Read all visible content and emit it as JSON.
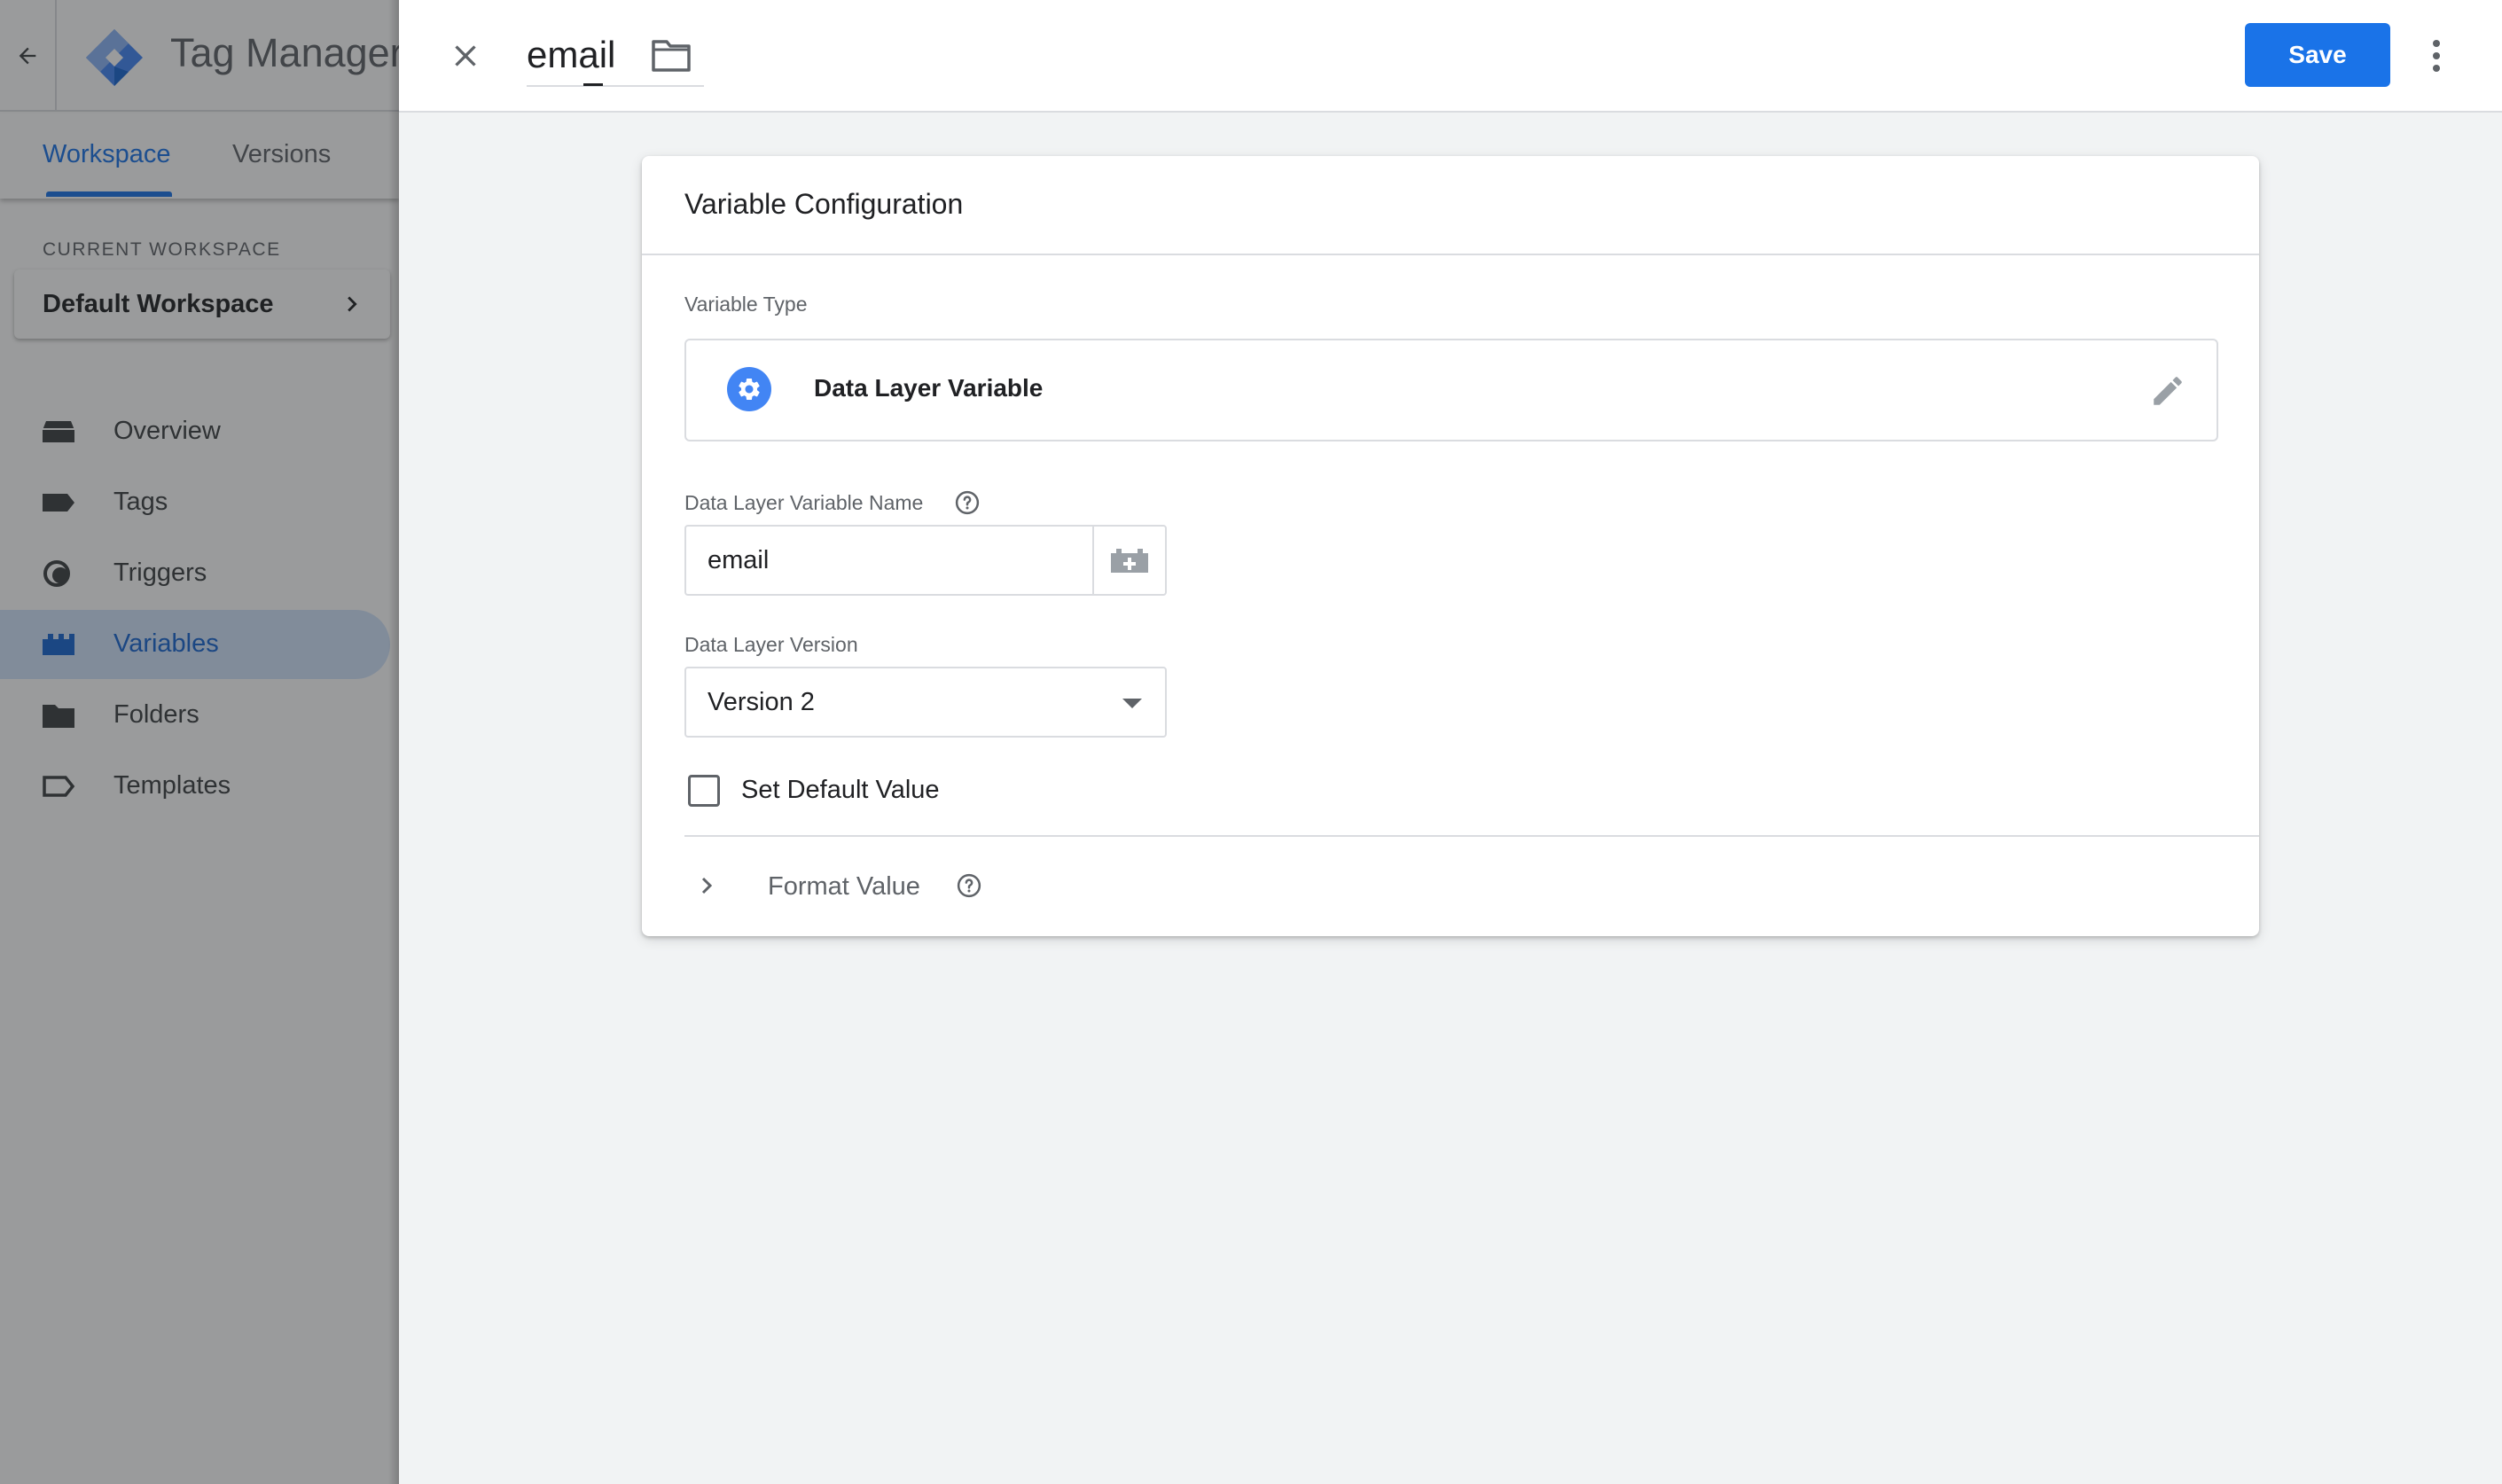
{
  "app": {
    "title": "Tag Manager",
    "tabs": [
      {
        "label": "Workspace",
        "active": true
      },
      {
        "label": "Versions",
        "active": false
      }
    ],
    "current_workspace_label": "CURRENT WORKSPACE",
    "current_workspace": "Default Workspace",
    "nav": [
      {
        "label": "Overview",
        "icon": "overview-icon",
        "active": false
      },
      {
        "label": "Tags",
        "icon": "tag-icon",
        "active": false
      },
      {
        "label": "Triggers",
        "icon": "trigger-icon",
        "active": false
      },
      {
        "label": "Variables",
        "icon": "variables-icon",
        "active": true
      },
      {
        "label": "Folders",
        "icon": "folder-icon",
        "active": false
      },
      {
        "label": "Templates",
        "icon": "template-icon",
        "active": false
      }
    ]
  },
  "editor": {
    "name": "email",
    "save_label": "Save"
  },
  "card": {
    "title": "Variable Configuration",
    "variable_type_label": "Variable Type",
    "variable_type": "Data Layer Variable",
    "dlv_name_label": "Data Layer Variable Name",
    "dlv_name_value": "email",
    "dlv_version_label": "Data Layer Version",
    "dlv_version_value": "Version 2",
    "default_value_label": "Set Default Value",
    "default_value_checked": false,
    "format_value_label": "Format Value"
  },
  "colors": {
    "accent": "#1a73e8",
    "active_nav_bg": "#d2e3fc",
    "page_bg": "#f1f3f4",
    "logo_blue": "#4285f4",
    "logo_dark": "#1967d2"
  }
}
